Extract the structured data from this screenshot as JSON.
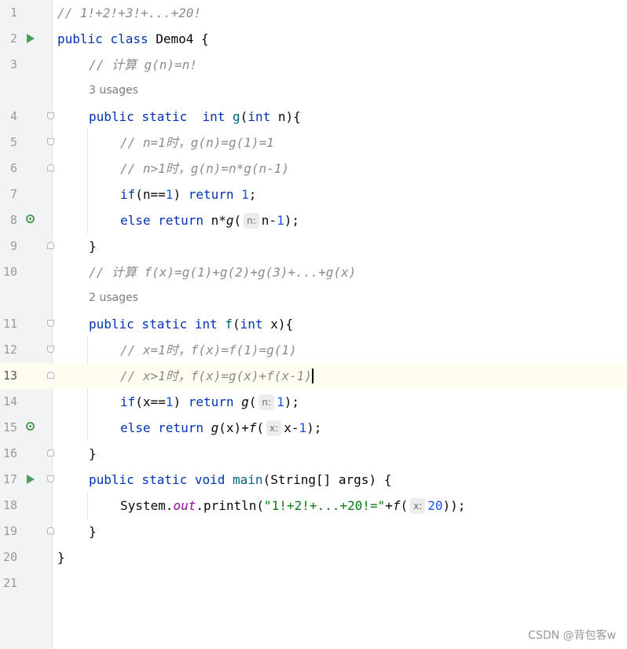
{
  "editor": {
    "line_numbers": [
      "1",
      "2",
      "3",
      "4",
      "5",
      "6",
      "7",
      "8",
      "9",
      "10",
      "11",
      "12",
      "13",
      "14",
      "15",
      "16",
      "17",
      "18",
      "19",
      "20",
      "21"
    ],
    "current_line": "13",
    "lines": {
      "l1": "// 1!+2!+3!+...+20!",
      "l2": {
        "kw": "public class ",
        "name": "Demo4 {"
      },
      "l3": "// 计算 g(n)=n!",
      "usages1": "3 usages",
      "l4": {
        "kw": "public static  int ",
        "fn": "g",
        "p1": "(",
        "kw2": "int",
        "rest": " n){"
      },
      "l5": "// n=1时，g(n)=g(1)=1",
      "l6": "// n>1时，g(n)=n*g(n-1)",
      "l7": {
        "kw": "if",
        "a": "(n==",
        "num": "1",
        "b": ") ",
        "kw2": "return ",
        "num2": "1",
        "c": ";"
      },
      "l8": {
        "kw": "else return ",
        "a": "n*",
        "fn": "g",
        "b": "(",
        "hint": "n:",
        "c": "n-",
        "num": "1",
        "d": ");"
      },
      "l9": "}",
      "l10": "// 计算 f(x)=g(1)+g(2)+g(3)+...+g(x)",
      "usages2": "2 usages",
      "l11": {
        "kw": "public static int ",
        "fn": "f",
        "p1": "(",
        "kw2": "int",
        "rest": " x){"
      },
      "l12": "// x=1时，f(x)=f(1)=g(1)",
      "l13": "// x>1时，f(x)=g(x)+f(x-1)",
      "l14": {
        "kw": "if",
        "a": "(x==",
        "num": "1",
        "b": ") ",
        "kw2": "return ",
        "fn": "g",
        "c": "(",
        "hint": "n:",
        "num2": "1",
        "d": ");"
      },
      "l15": {
        "kw": "else return ",
        "fn": "g",
        "a": "(x)+",
        "fn2": "f",
        "b": "(",
        "hint": "x:",
        "c": "x-",
        "num": "1",
        "d": ");"
      },
      "l16": "}",
      "l17": {
        "kw": "public static void ",
        "fn": "main",
        "rest": "(String[] args) {"
      },
      "l18": {
        "a": "System.",
        "st": "out",
        "b": ".println(",
        "str": "\"1!+2!+...+20!=\"",
        "c": "+",
        "fn": "f",
        "d": "(",
        "hint": "x:",
        "num": "20",
        "e": "));"
      },
      "l19": "}",
      "l20": "}"
    },
    "gutter_icons": {
      "run": "run-triangle-icon",
      "recursion": "recursive-call-icon",
      "fold": "fold-marker-icon"
    },
    "colors": {
      "keyword": "#0033b3",
      "function": "#00627a",
      "number": "#1750eb",
      "string": "#067d17",
      "comment": "#8c8c8c",
      "static_field": "#871094",
      "current_line_bg": "#fefdf0"
    }
  },
  "watermark": "CSDN @背包客w"
}
